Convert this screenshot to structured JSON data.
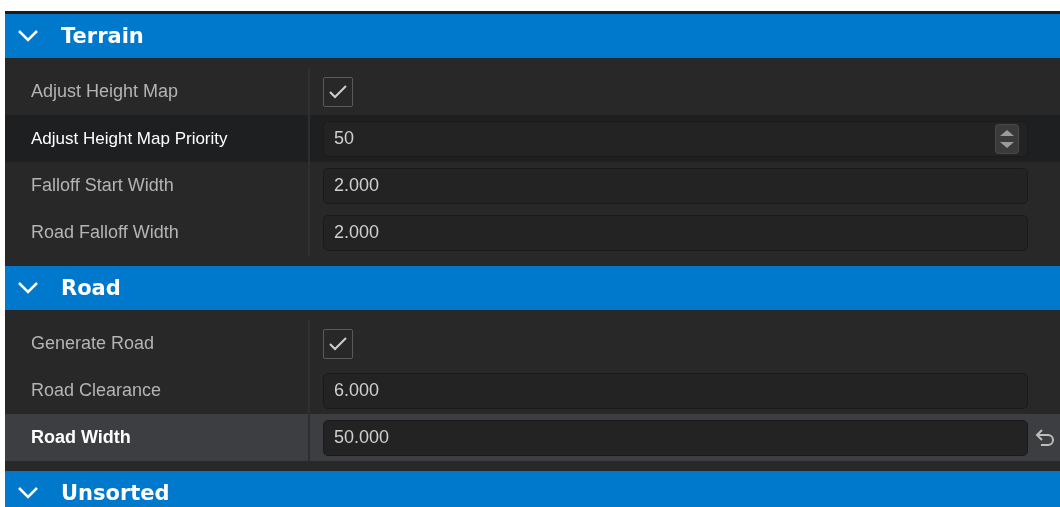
{
  "sections": [
    {
      "title": "Terrain",
      "expanded": true,
      "rows": [
        {
          "label": "Adjust Height Map",
          "kind": "checkbox",
          "checked": true,
          "focused": false,
          "hovered": false,
          "modified": false
        },
        {
          "label": "Adjust Height Map Priority",
          "kind": "spinner",
          "value": "50",
          "focused": true,
          "hovered": false,
          "modified": false
        },
        {
          "label": "Falloff Start Width",
          "kind": "number",
          "value": "2.000",
          "focused": false,
          "hovered": false,
          "modified": false
        },
        {
          "label": "Road Falloff Width",
          "kind": "number",
          "value": "2.000",
          "focused": false,
          "hovered": false,
          "modified": false
        }
      ]
    },
    {
      "title": "Road",
      "expanded": true,
      "rows": [
        {
          "label": "Generate Road",
          "kind": "checkbox",
          "checked": true,
          "focused": false,
          "hovered": false,
          "modified": false
        },
        {
          "label": "Road Clearance",
          "kind": "number",
          "value": "6.000",
          "focused": false,
          "hovered": false,
          "modified": false
        },
        {
          "label": "Road Width",
          "kind": "number",
          "value": "50.000",
          "focused": false,
          "hovered": true,
          "modified": true
        }
      ]
    },
    {
      "title": "Unsorted",
      "expanded": true
    }
  ]
}
